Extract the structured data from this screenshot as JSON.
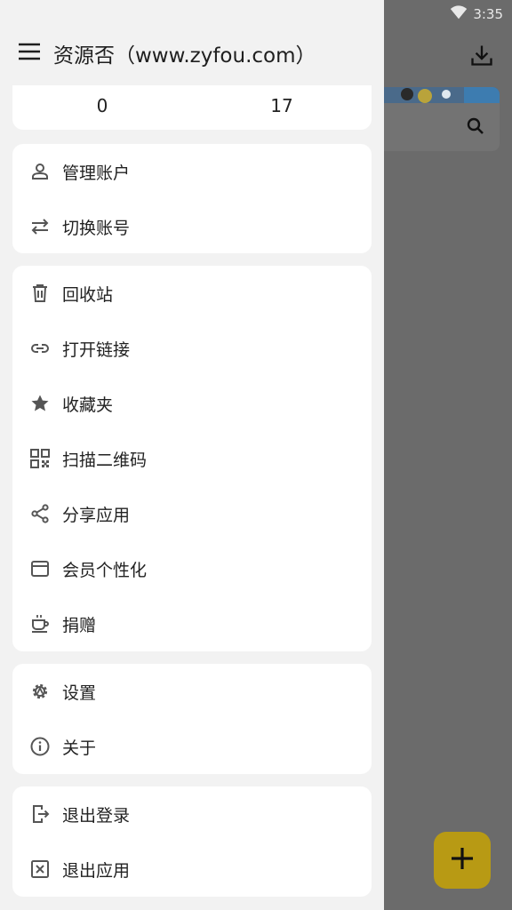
{
  "status": {
    "time": "3:35"
  },
  "header": {
    "title": "资源否（www.zyfou.com）"
  },
  "stats": [
    {
      "value": "0"
    },
    {
      "value": "17"
    }
  ],
  "menu": {
    "account": [
      {
        "label": "管理账户",
        "icon": "person-icon"
      },
      {
        "label": "切换账号",
        "icon": "swap-icon"
      }
    ],
    "tools": [
      {
        "label": "回收站",
        "icon": "trash-icon"
      },
      {
        "label": "打开链接",
        "icon": "link-icon"
      },
      {
        "label": "收藏夹",
        "icon": "star-icon"
      },
      {
        "label": "扫描二维码",
        "icon": "qr-code-icon"
      },
      {
        "label": "分享应用",
        "icon": "share-icon"
      },
      {
        "label": "会员个性化",
        "icon": "wallet-icon"
      },
      {
        "label": "捐赠",
        "icon": "coffee-icon"
      }
    ],
    "settings": [
      {
        "label": "设置",
        "icon": "gear-icon"
      },
      {
        "label": "关于",
        "icon": "info-icon"
      }
    ],
    "exit": [
      {
        "label": "退出登录",
        "icon": "logout-icon"
      },
      {
        "label": "退出应用",
        "icon": "close-box-icon"
      }
    ]
  },
  "colors": {
    "fab": "#b89a14",
    "drawer_bg": "#f2f2f2",
    "scrim": "#6b6b6b"
  }
}
